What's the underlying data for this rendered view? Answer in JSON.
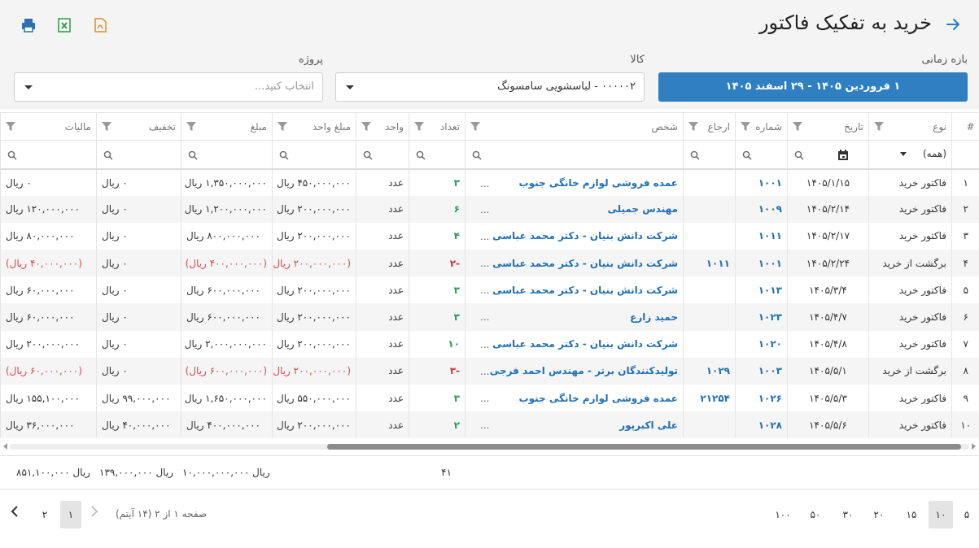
{
  "header": {
    "title": "خرید به تفکیک فاکتور"
  },
  "filters": {
    "date_label": "بازه زمانی",
    "date_range": "۱ فروردین ۱۴۰۵ - ۲۹ اسفند ۱۴۰۵",
    "kala_label": "کالا",
    "kala_value": "۰۰۰۰۰۲ - لباسشویی سامسونگ",
    "project_label": "پروژه",
    "project_placeholder": "انتخاب کنید..."
  },
  "columns": [
    "#",
    "نوع",
    "تاریخ",
    "شماره",
    "ارجاع",
    "شخص",
    "تعداد",
    "واحد",
    "مبلغ واحد",
    "مبلغ",
    "تخفیف",
    "مالیات"
  ],
  "type_filter": "(همه)",
  "rows": [
    {
      "n": "۱",
      "type": "فاکتور خرید",
      "date": "۱۴۰۵/۱/۱۵",
      "num": "۱۰۰۱",
      "ref": "",
      "person": "عمده فروشی لوازم خانگی جنوب",
      "qty": "۳",
      "unit": "عدد",
      "unit_price": "۴۵۰,۰۰۰,۰۰۰ ریال",
      "amount": "۱,۳۵۰,۰۰۰,۰۰۰ ریال",
      "discount": "۰ ریال",
      "tax": "۰ ریال",
      "neg": false
    },
    {
      "n": "۲",
      "type": "فاکتور خرید",
      "date": "۱۴۰۵/۲/۱۴",
      "num": "۱۰۰۹",
      "ref": "",
      "person": "مهندس جمیلی",
      "qty": "۶",
      "unit": "عدد",
      "unit_price": "۲۰۰,۰۰۰,۰۰۰ ریال",
      "amount": "۱,۲۰۰,۰۰۰,۰۰۰ ریال",
      "discount": "۰ ریال",
      "tax": "۱۲۰,۰۰۰,۰۰۰ ریال",
      "neg": false
    },
    {
      "n": "۳",
      "type": "فاکتور خرید",
      "date": "۱۴۰۵/۲/۱۷",
      "num": "۱۰۱۱",
      "ref": "",
      "person": "شرکت دانش بنیان - دکتر محمد عباسی",
      "qty": "۴",
      "unit": "عدد",
      "unit_price": "۲۰۰,۰۰۰,۰۰۰ ریال",
      "amount": "۸۰۰,۰۰۰,۰۰۰ ریال",
      "discount": "۰ ریال",
      "tax": "۸۰,۰۰۰,۰۰۰ ریال",
      "neg": false
    },
    {
      "n": "۴",
      "type": "برگشت از خرید",
      "date": "۱۴۰۵/۲/۲۴",
      "num": "۱۰۰۱",
      "ref": "۱۰۱۱",
      "person": "شرکت دانش بنیان - دکتر محمد عباسی",
      "qty": "-۲",
      "unit": "عدد",
      "unit_price": "(۲۰۰,۰۰۰,۰۰۰ ریال)",
      "amount": "(۴۰۰,۰۰۰,۰۰۰ ریال)",
      "discount": "۰ ریال",
      "tax": "(۴۰,۰۰۰,۰۰۰ ریال)",
      "neg": true
    },
    {
      "n": "۵",
      "type": "فاکتور خرید",
      "date": "۱۴۰۵/۳/۴",
      "num": "۱۰۱۳",
      "ref": "",
      "person": "شرکت دانش بنیان - دکتر محمد عباسی",
      "qty": "۳",
      "unit": "عدد",
      "unit_price": "۲۰۰,۰۰۰,۰۰۰ ریال",
      "amount": "۶۰۰,۰۰۰,۰۰۰ ریال",
      "discount": "۰ ریال",
      "tax": "۶۰,۰۰۰,۰۰۰ ریال",
      "neg": false
    },
    {
      "n": "۶",
      "type": "فاکتور خرید",
      "date": "۱۴۰۵/۴/۷",
      "num": "۱۰۲۳",
      "ref": "",
      "person": "حمید زارع",
      "qty": "۳",
      "unit": "عدد",
      "unit_price": "۲۰۰,۰۰۰,۰۰۰ ریال",
      "amount": "۶۰۰,۰۰۰,۰۰۰ ریال",
      "discount": "۰ ریال",
      "tax": "۶۰,۰۰۰,۰۰۰ ریال",
      "neg": false
    },
    {
      "n": "۷",
      "type": "فاکتور خرید",
      "date": "۱۴۰۵/۴/۸",
      "num": "۱۰۲۰",
      "ref": "",
      "person": "شرکت دانش بنیان - دکتر محمد عباسی",
      "qty": "۱۰",
      "unit": "عدد",
      "unit_price": "۲۰۰,۰۰۰,۰۰۰ ریال",
      "amount": "۲,۰۰۰,۰۰۰,۰۰۰ ریال",
      "discount": "۰ ریال",
      "tax": "۲۰۰,۰۰۰,۰۰۰ ریال",
      "neg": false
    },
    {
      "n": "۸",
      "type": "برگشت از خرید",
      "date": "۱۴۰۵/۵/۱",
      "num": "۱۰۰۳",
      "ref": "۱۰۲۹",
      "person": "تولیدکنندگان برتر - مهندس احمد فرجی",
      "qty": "-۳",
      "unit": "عدد",
      "unit_price": "(۲۰۰,۰۰۰,۰۰۰ ریال)",
      "amount": "(۶۰۰,۰۰۰,۰۰۰ ریال)",
      "discount": "۰ ریال",
      "tax": "(۶۰,۰۰۰,۰۰۰ ریال)",
      "neg": true
    },
    {
      "n": "۹",
      "type": "فاکتور خرید",
      "date": "۱۴۰۵/۵/۳",
      "num": "۱۰۲۶",
      "ref": "۲۱۲۵۴",
      "person": "عمده فروشی لوازم خانگی جنوب",
      "qty": "۳",
      "unit": "عدد",
      "unit_price": "۵۵۰,۰۰۰,۰۰۰ ریال",
      "amount": "۱,۶۵۰,۰۰۰,۰۰۰ ریال",
      "discount": "۹۹,۰۰۰,۰۰۰ ریال",
      "tax": "۱۵۵,۱۰۰,۰۰۰ ریال",
      "neg": false
    },
    {
      "n": "۱۰",
      "type": "فاکتور خرید",
      "date": "۱۴۰۵/۵/۶",
      "num": "۱۰۲۸",
      "ref": "",
      "person": "علی اکبرپور",
      "qty": "۲",
      "unit": "عدد",
      "unit_price": "۲۰۰,۰۰۰,۰۰۰ ریال",
      "amount": "۴۰۰,۰۰۰,۰۰۰ ریال",
      "discount": "۴۰,۰۰۰,۰۰۰ ریال",
      "tax": "۳۶,۰۰۰,۰۰۰ ریال",
      "neg": false
    }
  ],
  "totals": {
    "qty": "۴۱",
    "amount": "۱۰,۰۰۰,۰۰۰,۰۰۰ ریال",
    "discount": "۱۳۹,۰۰۰,۰۰۰ ریال",
    "tax": "۸۵۱,۱۰۰,۰۰۰ ریال"
  },
  "pager": {
    "sizes": [
      "۵",
      "۱۰",
      "۱۵",
      "۲۰",
      "۳۰",
      "۵۰",
      "۱۰۰"
    ],
    "active_size": "۱۰",
    "info": "صفحه ۱ از ۲ (۱۴ آیتم)",
    "pages": [
      "۱",
      "۲"
    ],
    "active_page": "۱"
  },
  "colors": {
    "accent": "#2f7fc1",
    "link": "#1f6fb5",
    "positive_qty": "#2a9a5a",
    "negative": "#d84a4a",
    "excel": "#2e9a4a",
    "pdf": "#e08a2e"
  }
}
